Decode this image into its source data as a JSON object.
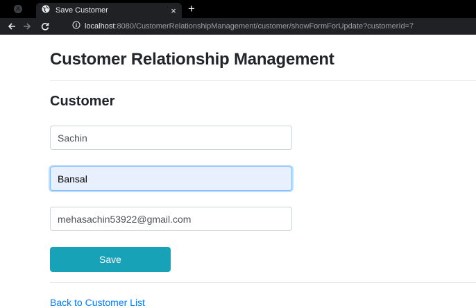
{
  "browser": {
    "tab_title": "Save Customer",
    "tab_close": "×",
    "new_tab": "+",
    "url_host": "localhost",
    "url_rest": ":8080/CustomerRelationshipManagement/customer/showFormForUpdate?customerId=7",
    "icons": [
      "github-icon",
      "globe-icon",
      "back-arrow-icon",
      "forward-arrow-icon",
      "reload-icon",
      "info-icon"
    ]
  },
  "page": {
    "title": "Customer Relationship Management",
    "subtitle": "Customer",
    "form": {
      "first_name": "Sachin",
      "last_name": "Bansal",
      "email": "mehasachin53922@gmail.com",
      "save_label": "Save"
    },
    "back_link": "Back to Customer List"
  },
  "colors": {
    "save_button": "#17a2b8",
    "link": "#007bff",
    "focused_field": "#e8f0fe"
  }
}
